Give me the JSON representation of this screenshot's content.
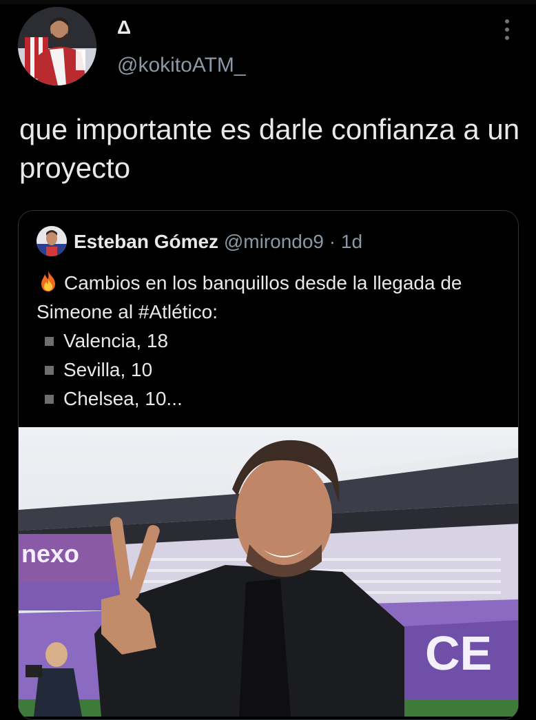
{
  "tweet": {
    "display_name": "Δ",
    "handle": "@kokitoATM_",
    "text": "que importante es darle confianza a un proyecto",
    "more_icon": "more-vertical-icon"
  },
  "quoted": {
    "name": "Esteban Gómez",
    "handle": "@mirondo9",
    "separator": "·",
    "time": "1d",
    "intro": "Cambios en los banquillos desde la llegada de Simeone al #Atlético:",
    "intro_icon": "fire-emoji",
    "items": [
      "Valencia, 18",
      "Sevilla, 10",
      "Chelsea, 10..."
    ],
    "photo_sign_text": "nexo",
    "photo_stand_text": "CE"
  }
}
